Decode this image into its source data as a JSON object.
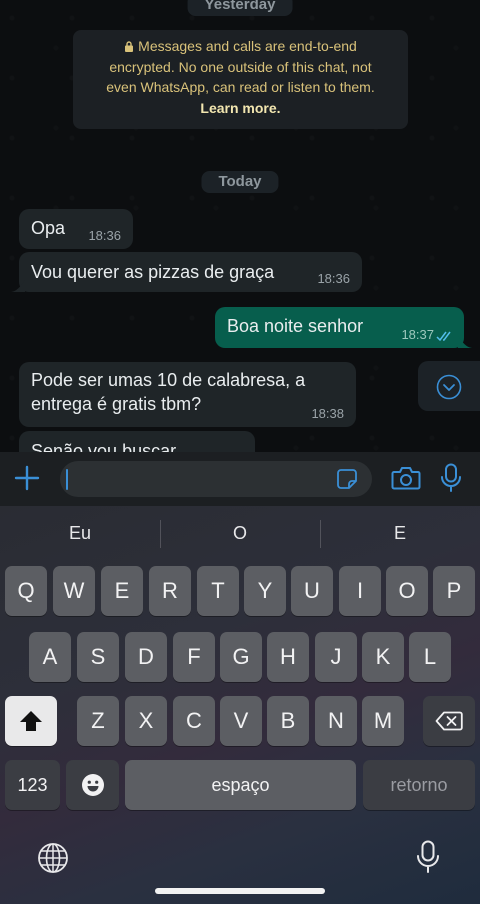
{
  "chat": {
    "date_yesterday": "Yesterday",
    "date_today": "Today",
    "encryption_notice": {
      "line1": "Messages and calls are end-to-end",
      "line2": "encrypted. No one outside of this chat, not",
      "line3": "even WhatsApp, can read or listen to them.",
      "link": "Learn more."
    },
    "messages": [
      {
        "direction": "in",
        "text": "Opa",
        "time": "18:36"
      },
      {
        "direction": "in",
        "text": "Vou querer as pizzas de graça",
        "time": "18:36"
      },
      {
        "direction": "out",
        "text": "Boa noite senhor",
        "time": "18:37",
        "status": "read"
      },
      {
        "direction": "in",
        "text": "Pode ser umas 10 de calabresa, a entrega é gratis tbm?",
        "time": "18:38"
      },
      {
        "direction": "in",
        "text": "Senão vou buscar",
        "time": ""
      }
    ]
  },
  "input_bar": {
    "value": "",
    "icons": [
      "plus-icon",
      "sticker-icon",
      "camera-icon",
      "mic-icon"
    ]
  },
  "keyboard": {
    "suggestions": [
      "Eu",
      "O",
      "E"
    ],
    "row1": [
      "Q",
      "W",
      "E",
      "R",
      "T",
      "Y",
      "U",
      "I",
      "O",
      "P"
    ],
    "row2": [
      "A",
      "S",
      "D",
      "F",
      "G",
      "H",
      "J",
      "K",
      "L"
    ],
    "row3": [
      "Z",
      "X",
      "C",
      "V",
      "B",
      "N",
      "M"
    ],
    "numbers_key": "123",
    "space_key": "espaço",
    "return_key": "retorno"
  },
  "colors": {
    "outgoing_bubble": "#075e4d",
    "incoming_bubble": "#1f2528",
    "accent_blue": "#3a8fd6",
    "notice_text": "#d9c27a"
  }
}
